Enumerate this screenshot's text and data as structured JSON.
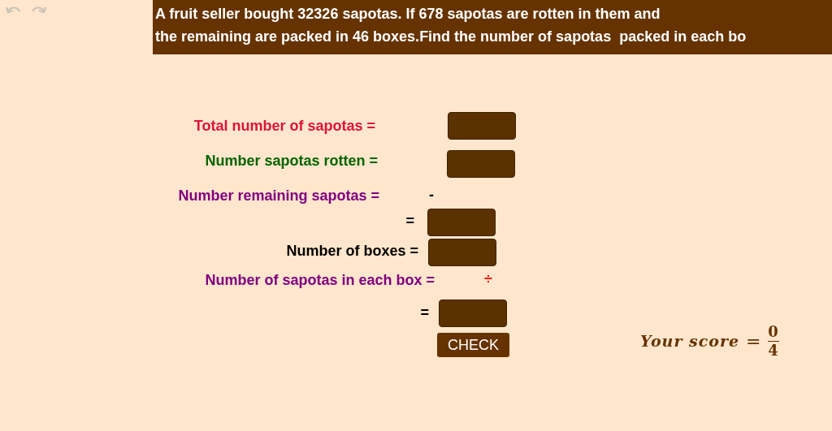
{
  "toolbar": [
    {
      "kind": "undo",
      "disabled": true
    },
    {
      "kind": "redo",
      "disabled": true
    }
  ],
  "question": {
    "lines": [
      "A fruit seller bought 32326 sapotas. If 678 sapotas are rotten in them and",
      "the remaining are packed in 46 boxes.Find the number of sapotas  packed in each bo"
    ]
  },
  "labels": [
    {
      "text": "Total number of sapotas =",
      "color": "#dc143c"
    },
    {
      "text": "Number sapotas rotten =",
      "color": "#006400"
    },
    {
      "text": "Number remaining sapotas =",
      "color": "#800080"
    },
    {
      "text": "=",
      "color": "#000000"
    },
    {
      "text": "Number of boxes =",
      "color": "#000000"
    },
    {
      "text": "Number of sapotas in each box =",
      "color": "#800080"
    },
    {
      "text": "=",
      "color": "#000000"
    }
  ],
  "operators": [
    {
      "symbol": "-",
      "color": "#000000"
    },
    {
      "symbol": "÷",
      "color": "#ff0000"
    }
  ],
  "check_button": {
    "label": "CHECK"
  },
  "score": {
    "label": "Your score",
    "equals": "=",
    "numerator": "0",
    "denominator": "4"
  }
}
